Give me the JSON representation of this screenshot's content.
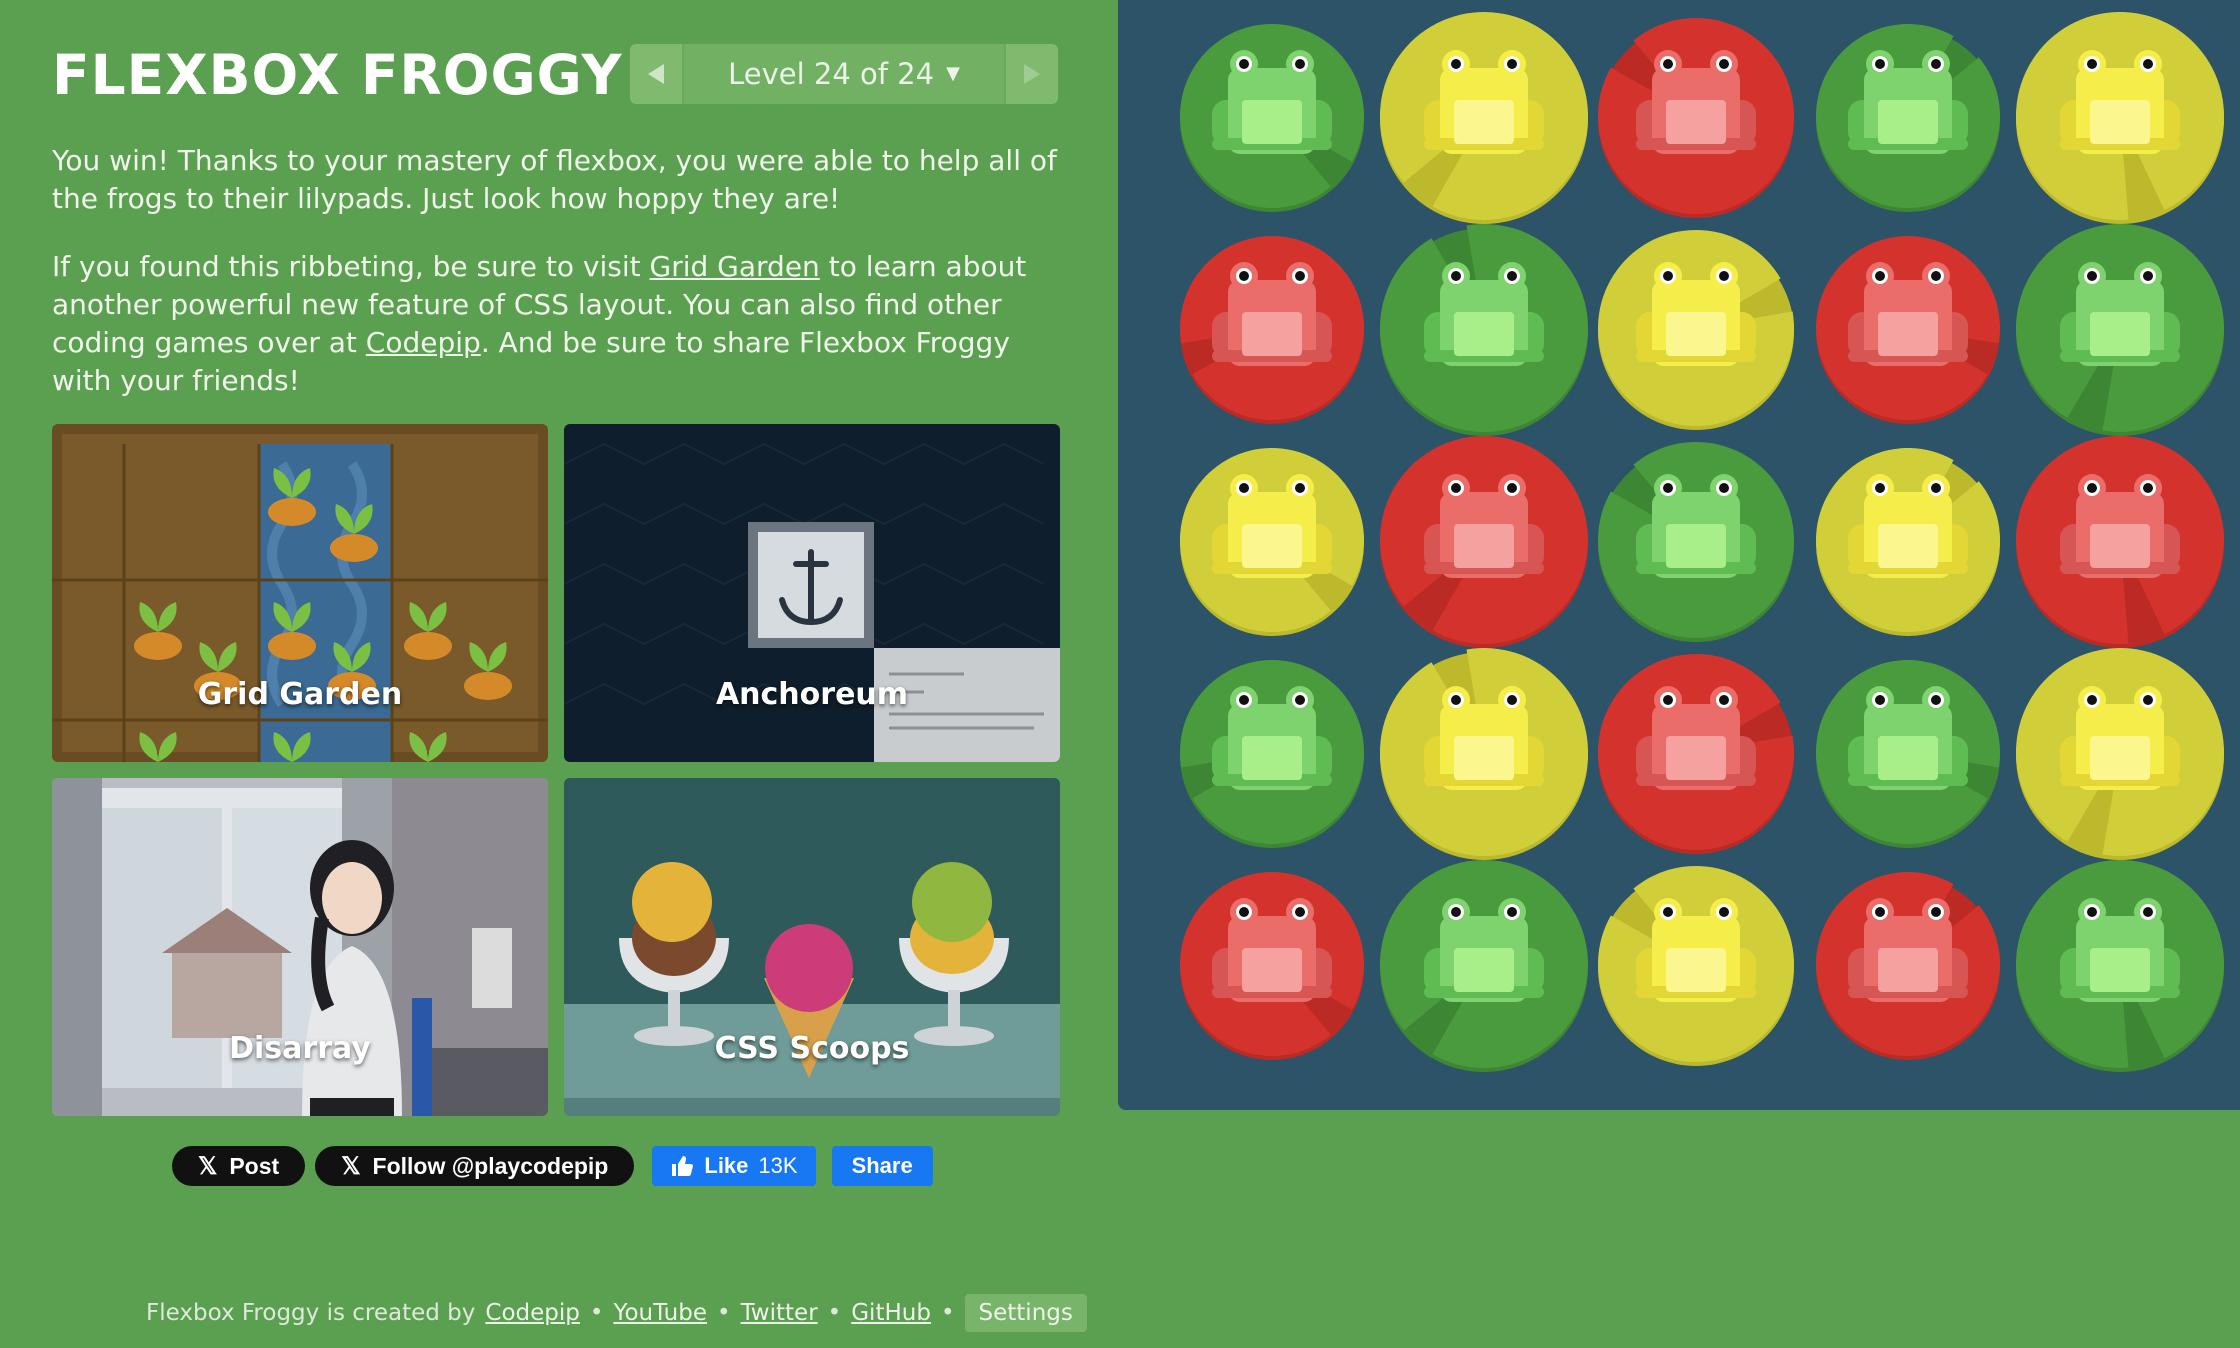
{
  "header": {
    "title": "FLEXBOX FROGGY",
    "level_label": "Level 24 of 24"
  },
  "instructions": {
    "p1": "You win! Thanks to your mastery of flexbox, you were able to help all of the frogs to their lilypads. Just look how hoppy they are!",
    "p2_before": "If you found this ribbeting, be sure to visit ",
    "p2_link1": "Grid Garden",
    "p2_middle": " to learn about another powerful new feature of CSS layout. You can also find other coding games over at ",
    "p2_link2": "Codepip",
    "p2_after": ". And be sure to share Flexbox Froggy with your friends!"
  },
  "tiles": [
    {
      "label": "Grid Garden"
    },
    {
      "label": "Anchoreum"
    },
    {
      "label": "Disarray"
    },
    {
      "label": "CSS Scoops"
    }
  ],
  "social": {
    "post": "Post",
    "follow": "Follow @playcodepip",
    "like": "Like",
    "like_count": "13K",
    "share": "Share"
  },
  "footer": {
    "text": "Flexbox Froggy is created by",
    "links": [
      "Codepip",
      "YouTube",
      "Twitter",
      "GitHub"
    ],
    "settings": "Settings"
  },
  "board": {
    "colors": {
      "green": "#4a9a3e",
      "yellow": "#d1cf39",
      "red": "#d3332c"
    },
    "rows": [
      [
        "green",
        "yellow",
        "red",
        "green",
        "yellow"
      ],
      [
        "red",
        "green",
        "yellow",
        "red",
        "green"
      ],
      [
        "yellow",
        "red",
        "green",
        "yellow",
        "red"
      ],
      [
        "green",
        "yellow",
        "red",
        "green",
        "yellow"
      ],
      [
        "red",
        "green",
        "yellow",
        "red",
        "green"
      ]
    ]
  },
  "colors": {
    "background": "#5ba050",
    "board": "#2c5367",
    "facebook": "#1877f2"
  }
}
